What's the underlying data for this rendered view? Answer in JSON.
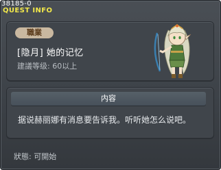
{
  "window": {
    "quest_id": "38185-0",
    "title": "QUEST INFO"
  },
  "summary": {
    "job_badge": "職業",
    "quest_name": "[隐月] 她的记忆",
    "level_requirement": "建議等级: 60以上"
  },
  "content": {
    "header": "内容",
    "text": "据说赫丽娜有消息要告诉我。听听她怎么说吧。"
  },
  "status": {
    "text": "狀態: 可開始"
  },
  "colors": {
    "title": "#f2e84a",
    "badge_bg": "#c9b8a0",
    "panel_bg": "#40454b"
  },
  "icons": {
    "npc": "npc-helena-portrait"
  }
}
